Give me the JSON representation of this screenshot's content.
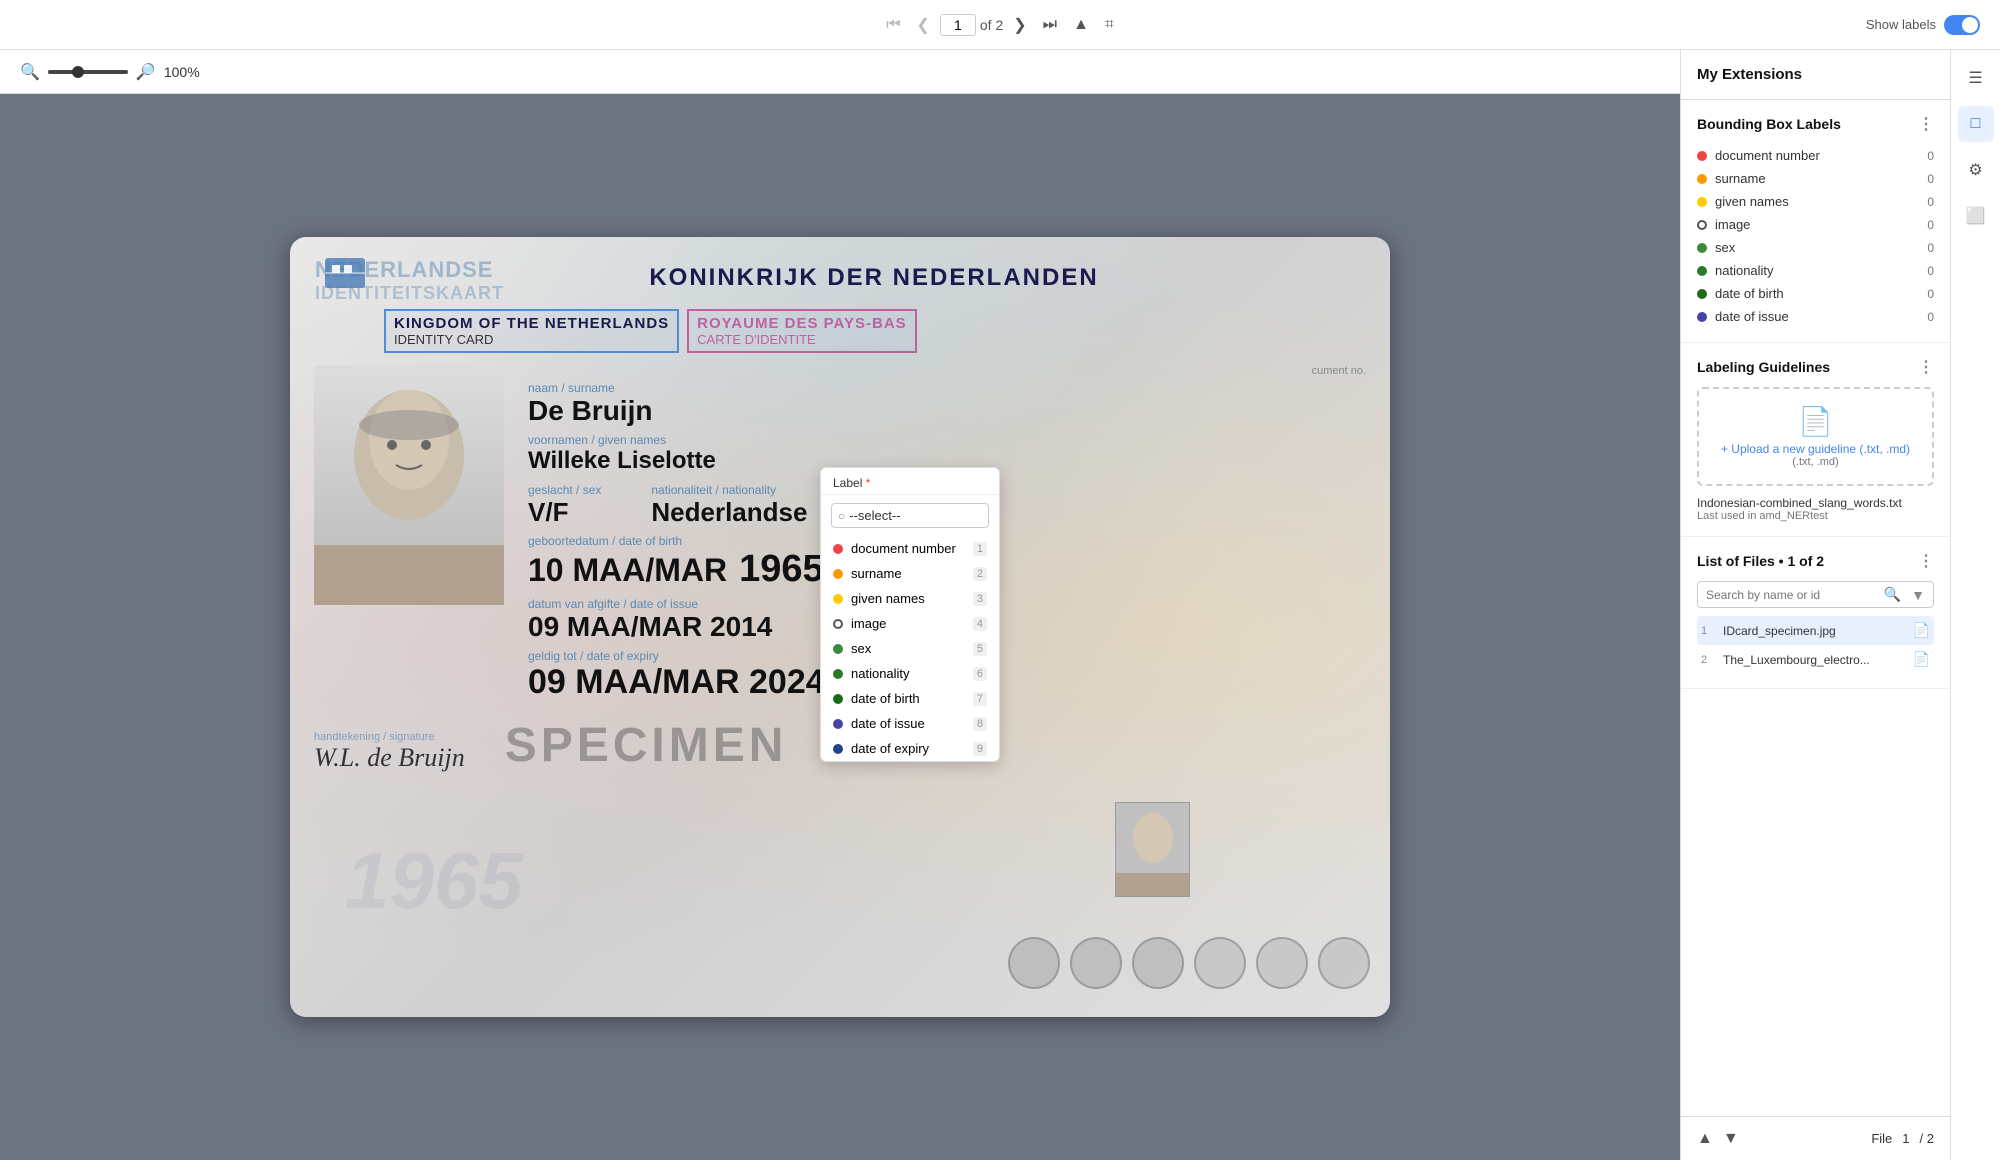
{
  "toolbar": {
    "page_current": "1",
    "page_of": "of 2",
    "show_labels": "Show labels",
    "zoom_percent": "100%"
  },
  "extensions_header": "My Extensions",
  "right_panel": {
    "bbox_section_title": "Bounding Box Labels",
    "labels": [
      {
        "name": "document number",
        "color": "red",
        "count": "0"
      },
      {
        "name": "surname",
        "color": "orange",
        "count": "0"
      },
      {
        "name": "given names",
        "color": "yellow",
        "count": "0"
      },
      {
        "name": "image",
        "color": "hollow",
        "count": "0"
      },
      {
        "name": "sex",
        "color": "green",
        "count": "0"
      },
      {
        "name": "nationality",
        "color": "green",
        "count": "0"
      },
      {
        "name": "date of birth",
        "color": "green",
        "count": "0"
      },
      {
        "name": "date of issue",
        "color": "blue",
        "count": "0"
      }
    ],
    "guidelines_section_title": "Labeling Guidelines",
    "guidelines_upload_text": "+ Upload a new guideline (.txt, .md)",
    "guidelines_file_name": "Indonesian-combined_slang_words.txt",
    "guidelines_file_date": "Last used in amd_NERtest",
    "files_section_title": "List of Files • 1 of 2",
    "file_search_placeholder": "Search by name or id",
    "files": [
      {
        "num": "1",
        "name": "IDcard_specimen.jpg",
        "active": true
      },
      {
        "num": "2",
        "name": "The_Luxembourg_electro...",
        "active": false
      }
    ]
  },
  "label_popup": {
    "header": "Label",
    "required": "*",
    "search_placeholder": "--select--",
    "options": [
      {
        "name": "document number",
        "color": "red",
        "shortcut": "1"
      },
      {
        "name": "surname",
        "color": "orange",
        "shortcut": "2"
      },
      {
        "name": "given names",
        "color": "yellow",
        "shortcut": "3"
      },
      {
        "name": "image",
        "color": "hollow",
        "shortcut": "4"
      },
      {
        "name": "sex",
        "color": "green",
        "shortcut": "5"
      },
      {
        "name": "nationality",
        "color": "green2",
        "shortcut": "6"
      },
      {
        "name": "date of birth",
        "color": "green3",
        "shortcut": "7"
      },
      {
        "name": "date of issue",
        "color": "blue",
        "shortcut": "8"
      },
      {
        "name": "date of expiry",
        "color": "darkblue",
        "shortcut": "9"
      }
    ]
  },
  "card": {
    "nl_line1": "NEDERLANDSE",
    "nl_line2": "IDENTITEITSKAART",
    "koninkrijk": "KONINKRIJK DER NEDERLANDEN",
    "title_en": "KINGDOM OF THE NETHERLANDS",
    "subtitle_en": "IDENTITY CARD",
    "title_fr": "ROYAUME DES PAYS-BAS",
    "subtitle_fr": "CARTE D'IDENTITE",
    "field_surname_label": "naam / surname",
    "field_surname_value": "De Bruijn",
    "field_given_label": "voornamen / given names",
    "field_given_value": "Willeke Liselotte",
    "field_sex_label": "geslacht / sex",
    "field_sex_value": "V/F",
    "field_nat_label": "nationaliteit / nationality",
    "field_nat_value": "Nederlandse",
    "field_dob_label": "geboortedatum / date of birth",
    "field_dob_value": "10 MAA/MAR",
    "field_dob_year": "1965",
    "field_issue_label": "datum van afgifte / date of issue",
    "field_issue_value": "09 MAA/MAR 2014",
    "field_expiry_label": "geldig tot / date of expiry",
    "field_expiry_value": "09 MAA/MAR 2024",
    "doc_no_label": "cument no.",
    "watermark_year": "1965",
    "specimen": "SPECIMEN",
    "signature_label": "handtekening / signature",
    "signature_value": "W.L. de Bruijn"
  },
  "bottom_bar": {
    "file_label": "File",
    "file_current": "1",
    "file_of": "/ 2"
  }
}
